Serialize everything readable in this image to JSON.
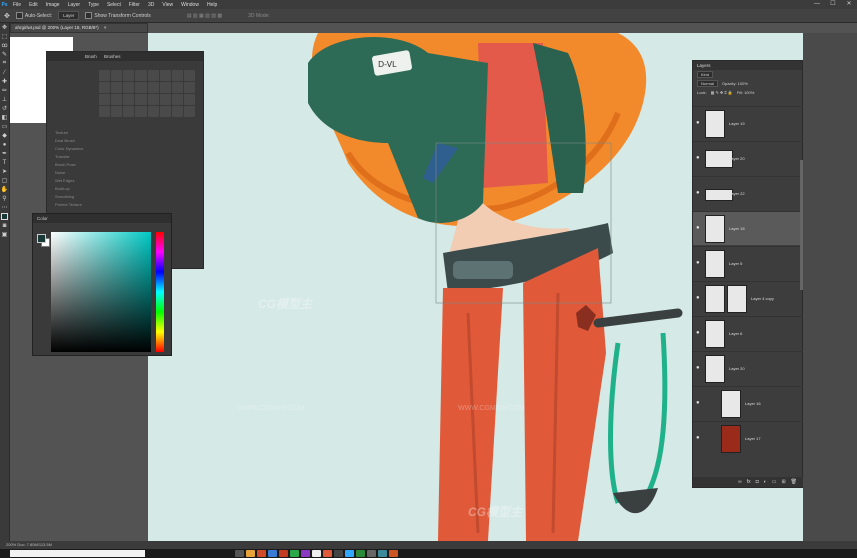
{
  "menubar": {
    "app_icon": "Ps",
    "items": [
      "File",
      "Edit",
      "Image",
      "Layer",
      "Type",
      "Select",
      "Filter",
      "3D",
      "View",
      "Window",
      "Help"
    ]
  },
  "window_controls": {
    "minimize": "—",
    "maximize": "☐",
    "close": "✕"
  },
  "optionsbar": {
    "auto_select_label": "Auto-Select:",
    "layer_value": "Layer",
    "transform_label": "Show Transform Controls",
    "mode_3d": "3D Mode:"
  },
  "document": {
    "tab_title": "ahrgirlwt.psd @ 200% (Layer 18, RGB/8*)",
    "close": "×"
  },
  "brushes_panel": {
    "tab_brush": "Brush",
    "tab_presets": "Brushes",
    "options": [
      "Texture",
      "Dual Brush",
      "Color Dynamics",
      "Transfer",
      "Brush Pose",
      "Noise",
      "Wet Edges",
      "Build-up",
      "Smoothing",
      "Protect Texture"
    ]
  },
  "color_panel": {
    "title": "Color"
  },
  "layers_panel": {
    "title": "Layers",
    "kind_value": "Kind",
    "blend_value": "Normal",
    "opacity_label": "Opacity: 100%",
    "lock_label": "Lock:",
    "fill_label": "Fill: 100%",
    "layers": [
      "Layer 19",
      "Layer 20",
      "Layer 22",
      "Layer 18",
      "Layer 5",
      "Layer 4 copy",
      "Layer 6",
      "Layer 20",
      "Layer 16",
      "Layer 17"
    ],
    "selected_index": 3
  },
  "status": {
    "text": "200%  Doc: 7.80M/113.5M"
  },
  "watermark": {
    "brand": "CG模型主",
    "url": "WWW.CGMXW.COM"
  },
  "colors": {
    "canvas": "#d5e9e6",
    "accent_cyan": "#00c9c4",
    "jacket": "#2e6b57",
    "hair": "#f28a2c",
    "pants": "#e05a3a"
  }
}
